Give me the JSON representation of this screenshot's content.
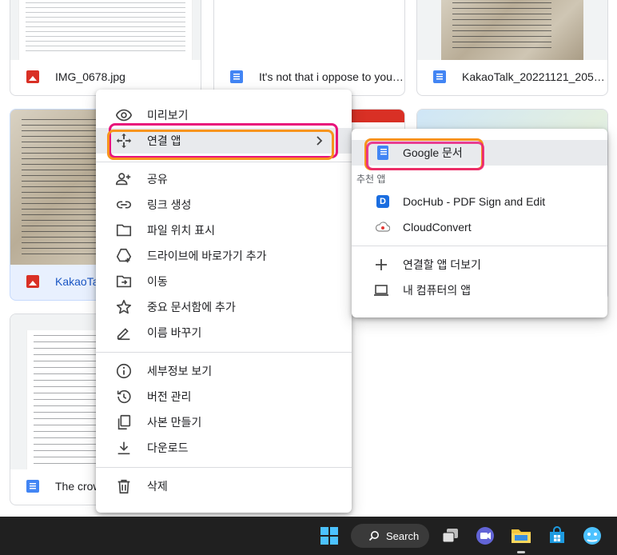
{
  "files": [
    {
      "name": "IMG_0678.jpg",
      "type": "image"
    },
    {
      "name": "It's not that i oppose to your...",
      "type": "doc"
    },
    {
      "name": "KakaoTalk_20221121_2056...",
      "type": "doc"
    },
    {
      "name": "KakaoTa",
      "type": "image"
    },
    {
      "name": "",
      "type": "map"
    },
    {
      "name": "The crow",
      "type": "doc"
    }
  ],
  "context_menu": {
    "items": [
      {
        "label": "미리보기",
        "icon": "eye-icon"
      },
      {
        "label": "연결 앱",
        "icon": "open-with-icon"
      },
      {
        "label": "공유",
        "icon": "person-add-icon"
      },
      {
        "label": "링크 생성",
        "icon": "link-icon"
      },
      {
        "label": "파일 위치 표시",
        "icon": "folder-icon"
      },
      {
        "label": "드라이브에 바로가기 추가",
        "icon": "add-shortcut-icon"
      },
      {
        "label": "이동",
        "icon": "move-icon"
      },
      {
        "label": "중요 문서함에 추가",
        "icon": "star-icon"
      },
      {
        "label": "이름 바꾸기",
        "icon": "pencil-icon"
      },
      {
        "label": "세부정보 보기",
        "icon": "info-icon"
      },
      {
        "label": "버전 관리",
        "icon": "history-icon"
      },
      {
        "label": "사본 만들기",
        "icon": "copy-icon"
      },
      {
        "label": "다운로드",
        "icon": "download-icon"
      },
      {
        "label": "삭제",
        "icon": "trash-icon"
      }
    ]
  },
  "submenu": {
    "primary": "Google 문서",
    "suggested_header": "추천 앱",
    "apps": [
      "DocHub - PDF Sign and Edit",
      "CloudConvert"
    ],
    "more": "연결할 앱 더보기",
    "computer": "내 컴퓨터의 앱"
  },
  "taskbar": {
    "search_label": "Search"
  },
  "colors": {
    "highlight_orange": "#f7941d",
    "highlight_pink": "#e8137b",
    "docs_blue": "#4285f4",
    "image_red": "#d93025"
  }
}
